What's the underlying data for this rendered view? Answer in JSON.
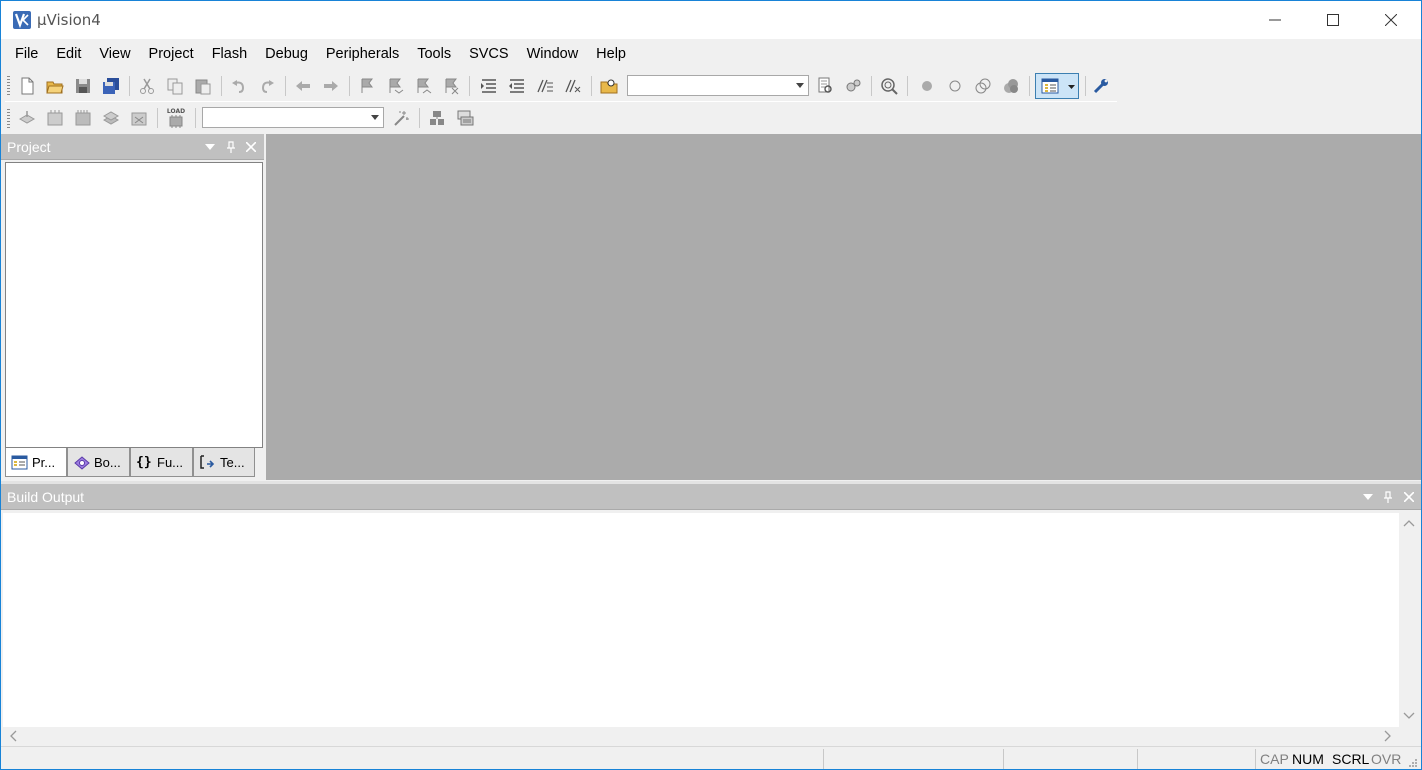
{
  "app": {
    "title": "µVision4",
    "icon": "uvision-logo-icon"
  },
  "window_controls": {
    "minimize": "minimize-icon",
    "maximize": "maximize-icon",
    "close": "close-icon"
  },
  "menu": [
    "File",
    "Edit",
    "View",
    "Project",
    "Flash",
    "Debug",
    "Peripherals",
    "Tools",
    "SVCS",
    "Window",
    "Help"
  ],
  "toolbar1": {
    "target_combo_value": "",
    "icons": [
      "new-file-icon",
      "open-file-icon",
      "save-icon",
      "save-all-icon",
      "cut-icon",
      "copy-icon",
      "paste-icon",
      "undo-icon",
      "redo-icon",
      "navigate-back-icon",
      "navigate-forward-icon",
      "bookmark-icon",
      "prev-bookmark-icon",
      "next-bookmark-icon",
      "clear-bookmarks-icon",
      "indent-icon",
      "unindent-icon",
      "comment-icon",
      "uncomment-icon",
      "find-in-files-icon",
      "find-icon",
      "incremental-find-icon",
      "debug-session-icon",
      "insert-breakpoint-icon",
      "enable-breakpoint-icon",
      "disable-breakpoints-icon",
      "kill-breakpoints-icon",
      "window-layout-icon",
      "configure-icon"
    ]
  },
  "toolbar2": {
    "target_select_value": "",
    "load_label": "LOAD",
    "icons": [
      "translate-icon",
      "build-icon",
      "rebuild-icon",
      "batch-build-icon",
      "stop-build-icon",
      "download-icon",
      "target-options-icon",
      "manage-components-icon",
      "select-packs-icon"
    ]
  },
  "project_panel": {
    "title": "Project",
    "tabs": [
      {
        "label": "Pr...",
        "icon": "project-tab-icon"
      },
      {
        "label": "Bo...",
        "icon": "books-tab-icon"
      },
      {
        "label": "Fu...",
        "icon": "functions-tab-icon"
      },
      {
        "label": "Te...",
        "icon": "templates-tab-icon"
      }
    ]
  },
  "build_output": {
    "title": "Build Output",
    "content": ""
  },
  "statusbar": {
    "cap": "CAP",
    "num": "NUM",
    "scrl": "SCRL",
    "ovr": "OVR"
  }
}
